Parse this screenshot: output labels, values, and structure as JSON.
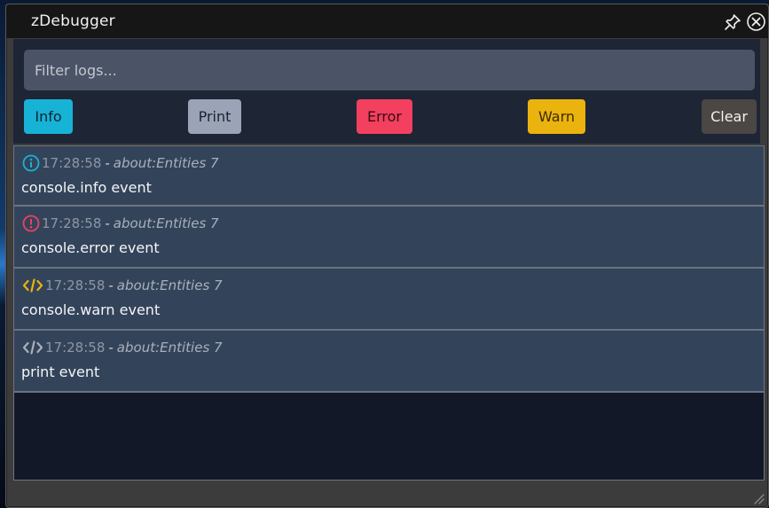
{
  "window": {
    "title": "zDebugger"
  },
  "filter": {
    "placeholder": "Filter logs...",
    "value": ""
  },
  "buttons": {
    "info": "Info",
    "print": "Print",
    "error": "Error",
    "warn": "Warn",
    "clear": "Clear"
  },
  "logs": [
    {
      "type": "info",
      "icon": "info-circle-icon",
      "time": "17:28:58",
      "separator": "-",
      "source": "about:Entities 7",
      "message": "console.info event"
    },
    {
      "type": "error",
      "icon": "exclamation-circle-icon",
      "time": "17:28:58",
      "separator": "-",
      "source": "about:Entities 7",
      "message": "console.error event"
    },
    {
      "type": "warn",
      "icon": "code-icon",
      "time": "17:28:58",
      "separator": "-",
      "source": "about:Entities 7",
      "message": "console.warn event"
    },
    {
      "type": "print",
      "icon": "code-icon",
      "time": "17:28:58",
      "separator": "-",
      "source": "about:Entities 7",
      "message": "print event"
    }
  ],
  "colors": {
    "info": "#17b3d6",
    "print": "#9aa4b6",
    "error": "#f2405e",
    "warn": "#ebb30d",
    "clear": "#4a4744"
  }
}
